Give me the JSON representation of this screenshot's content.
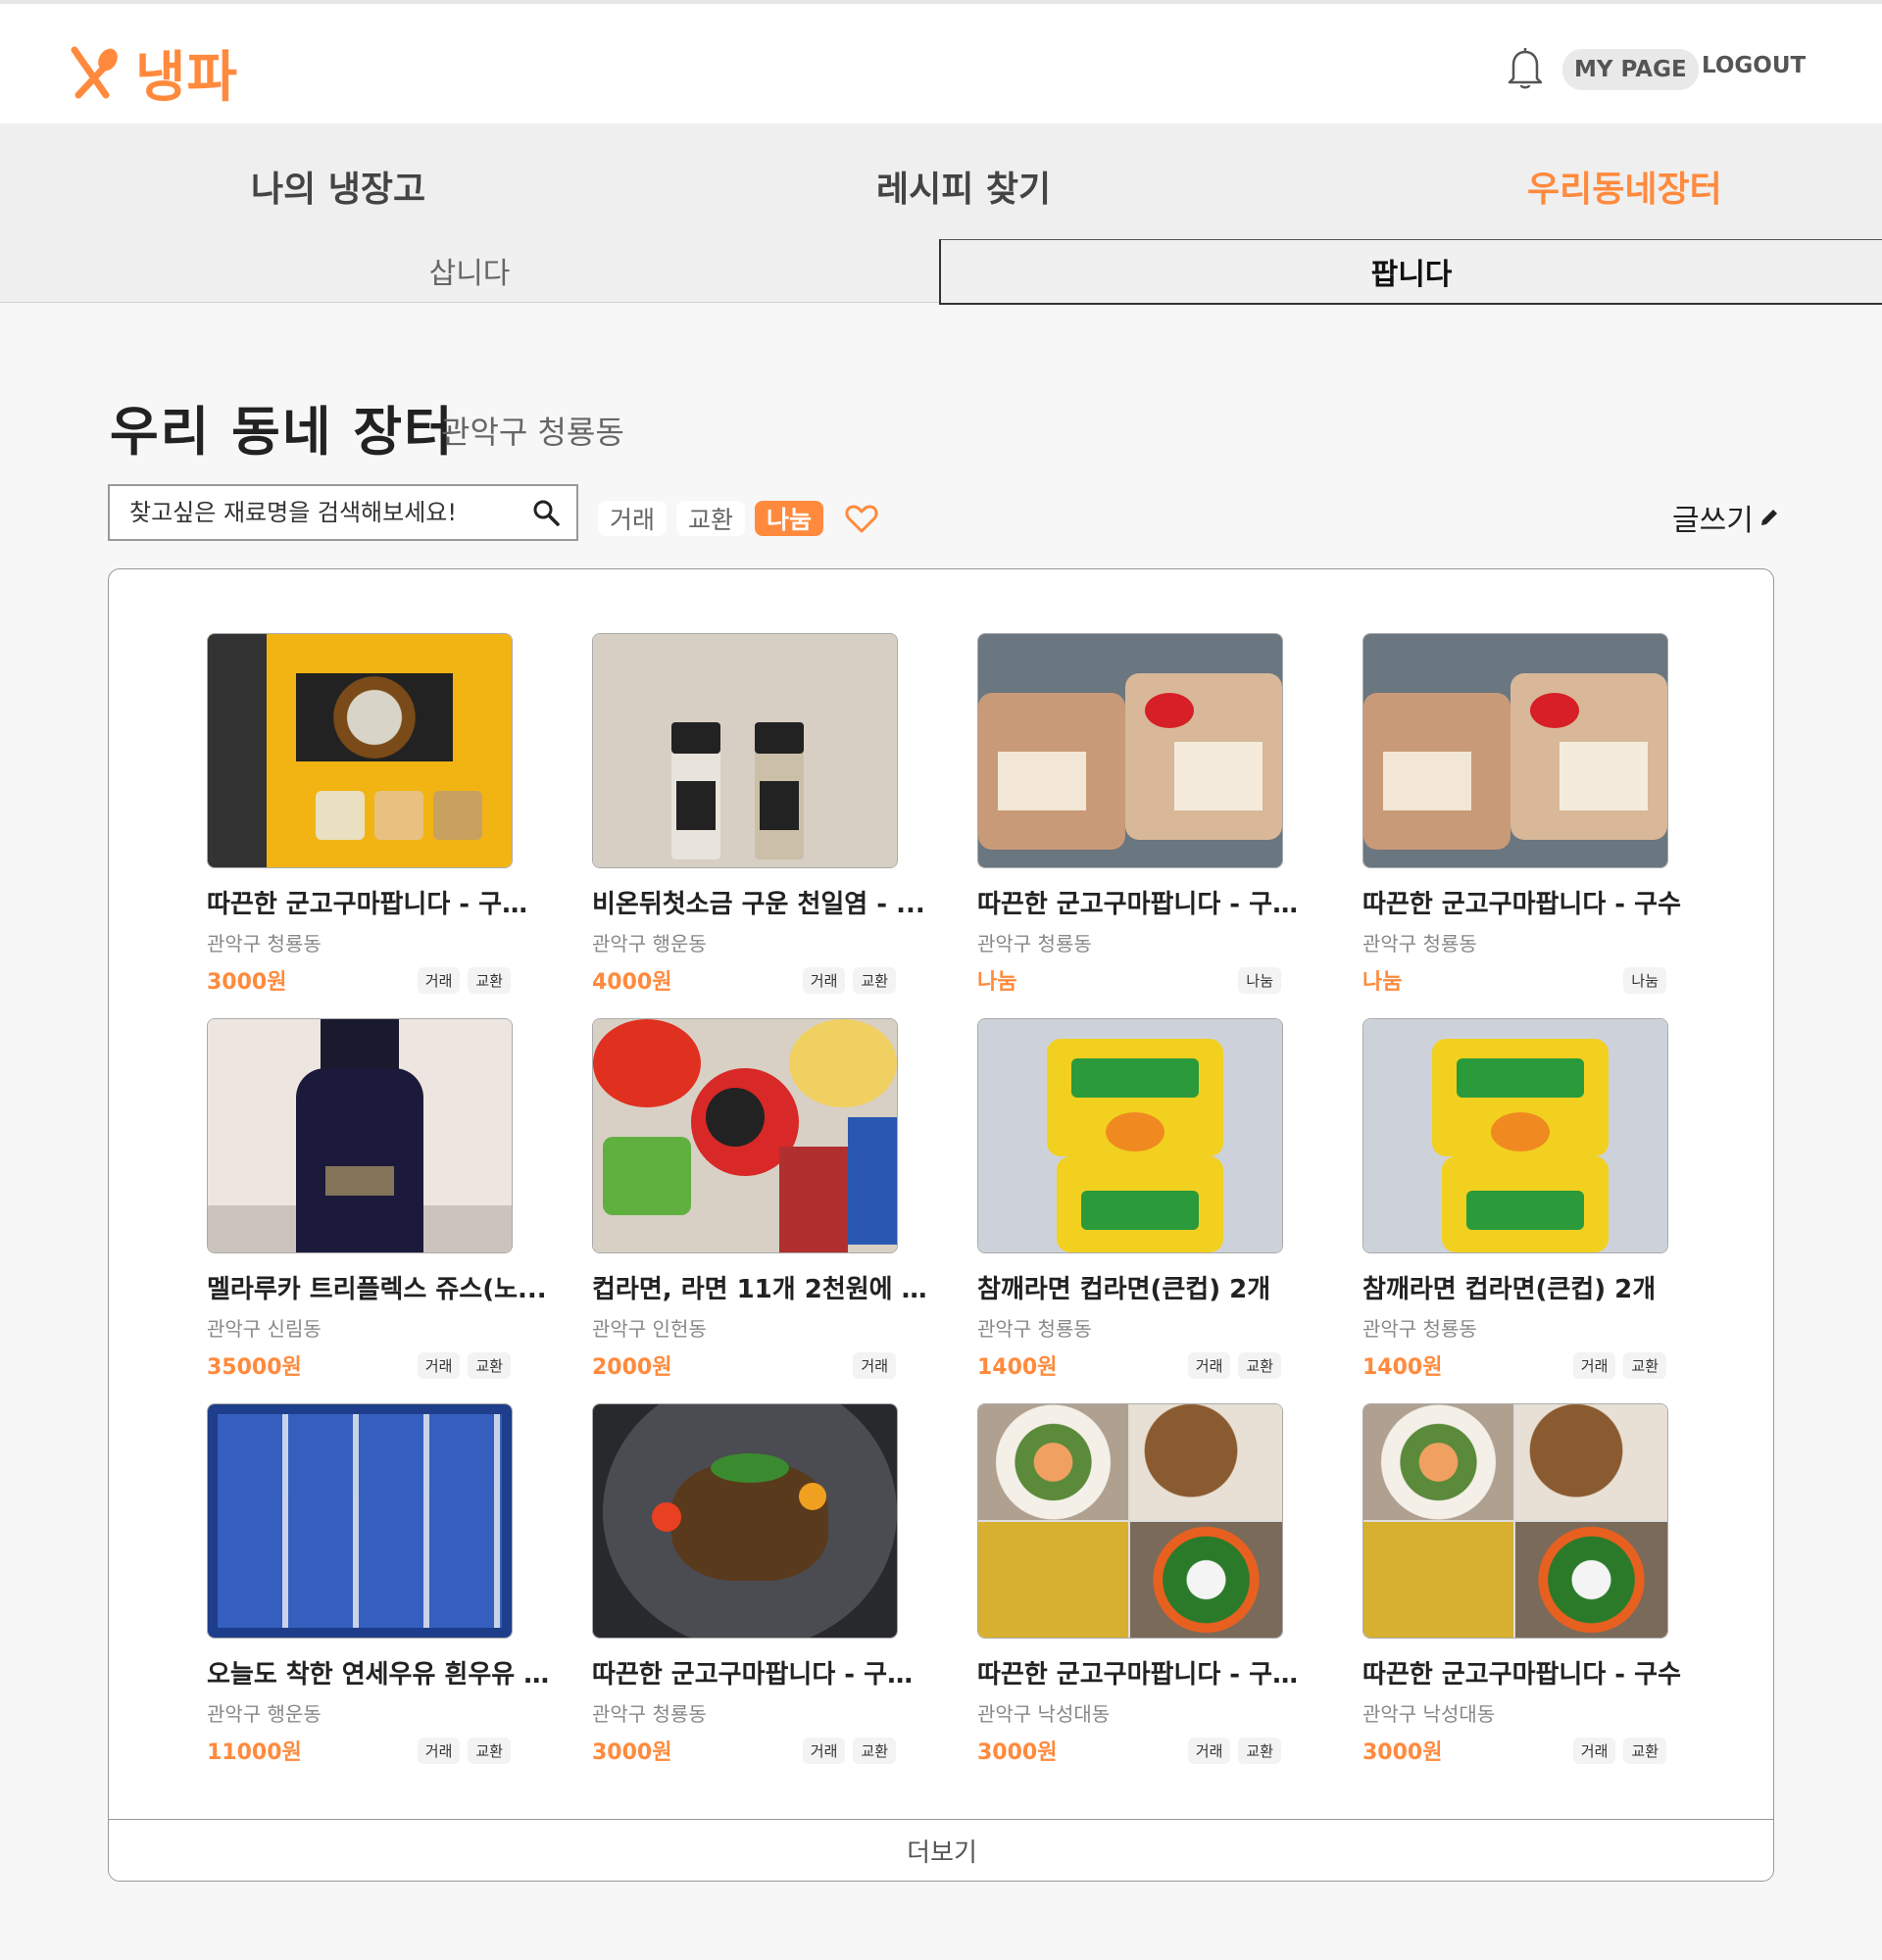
{
  "header": {
    "logo_text": "냉파",
    "mypage_label": "MY PAGE",
    "logout_label": "LOGOUT"
  },
  "nav": {
    "items": [
      {
        "label": "나의 냉장고",
        "active": false
      },
      {
        "label": "레시피 찾기",
        "active": false
      },
      {
        "label": "우리동네장터",
        "active": true
      }
    ]
  },
  "subtabs": {
    "buy": "삽니다",
    "sell": "팝니다",
    "selected": "sell"
  },
  "market": {
    "title": "우리 동네 장터",
    "location": "관악구 청룡동",
    "search_placeholder": "찾고싶은 재료명을 검색해보세요!",
    "filters": [
      {
        "label": "거래",
        "active": false
      },
      {
        "label": "교환",
        "active": false
      },
      {
        "label": "나눔",
        "active": true
      }
    ],
    "write_label": "글쓰기",
    "more_label": "더보기"
  },
  "products": [
    {
      "title": "따끈한 군고구마팝니다 - 구수...",
      "location": "관악구 청룡동",
      "price": "3000원",
      "tags": [
        "거래",
        "교환"
      ],
      "image": "packaged-snack-bag"
    },
    {
      "title": "비온뒤첫소금 구운 천일염 - ...",
      "location": "관악구 행운동",
      "price": "4000원",
      "tags": [
        "거래",
        "교환"
      ],
      "image": "salt-bottles"
    },
    {
      "title": "따끈한 군고구마팝니다 - 구수...",
      "location": "관악구 청룡동",
      "price": "나눔",
      "tags": [
        "나눔"
      ],
      "image": "cup-rice-bowls"
    },
    {
      "title": "따끈한 군고구마팝니다 - 구수",
      "location": "관악구 청룡동",
      "price": "나눔",
      "tags": [
        "나눔"
      ],
      "image": "cup-rice-bowls"
    },
    {
      "title": "멜라루카 트리플렉스 쥬스(노...",
      "location": "관악구 신림동",
      "price": "35000원",
      "tags": [
        "거래",
        "교환"
      ],
      "image": "juice-bottle"
    },
    {
      "title": "컵라면, 라면 11개 2천원에 팝...",
      "location": "관악구 인헌동",
      "price": "2000원",
      "tags": [
        "거래"
      ],
      "image": "ramen-pile"
    },
    {
      "title": "참깨라면 컵라면(큰컵) 2개",
      "location": "관악구 청룡동",
      "price": "1400원",
      "tags": [
        "거래",
        "교환"
      ],
      "image": "sesame-ramen-cups"
    },
    {
      "title": "참깨라면 컵라면(큰컵) 2개",
      "location": "관악구 청룡동",
      "price": "1400원",
      "tags": [
        "거래",
        "교환"
      ],
      "image": "sesame-ramen-cups"
    },
    {
      "title": "오늘도 착한 연세우유 흰우유 ...",
      "location": "관악구 행운동",
      "price": "11000원",
      "tags": [
        "거래",
        "교환"
      ],
      "image": "milk-cartons"
    },
    {
      "title": "따끈한 군고구마팝니다 - 구수...",
      "location": "관악구 청룡동",
      "price": "3000원",
      "tags": [
        "거래",
        "교환"
      ],
      "image": "plated-dish"
    },
    {
      "title": "따끈한 군고구마팝니다 - 구수...",
      "location": "관악구 낙성대동",
      "price": "3000원",
      "tags": [
        "거래",
        "교환"
      ],
      "image": "korean-food-collage"
    },
    {
      "title": "따끈한 군고구마팝니다 - 구수",
      "location": "관악구 낙성대동",
      "price": "3000원",
      "tags": [
        "거래",
        "교환"
      ],
      "image": "korean-food-collage"
    }
  ],
  "colors": {
    "accent": "#ff8a3d",
    "background": "#f7f7f7"
  }
}
